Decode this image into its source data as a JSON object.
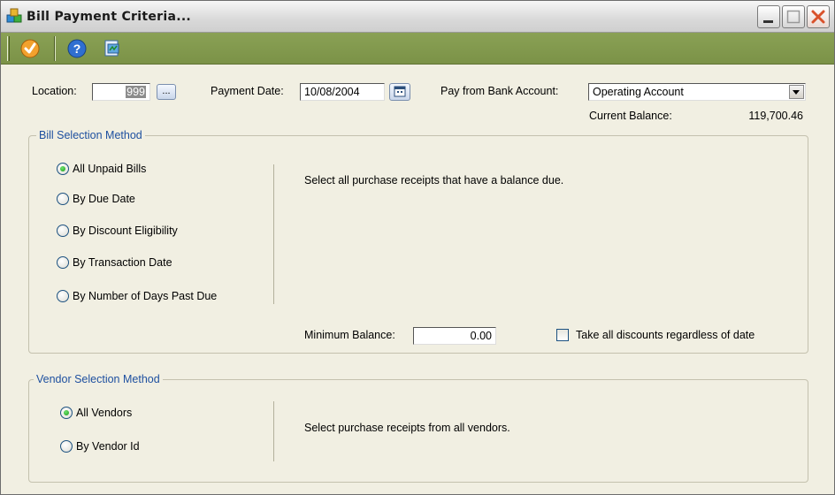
{
  "window": {
    "title": "Bill Payment Criteria..."
  },
  "toolbar": {
    "items": [
      {
        "name": "ok-checkmark-icon"
      },
      {
        "name": "help-icon"
      },
      {
        "name": "report-icon"
      }
    ]
  },
  "header": {
    "location_label": "Location:",
    "location_value": "999",
    "browse_label": "...",
    "payment_date_label": "Payment Date:",
    "payment_date_value": "10/08/2004",
    "bank_account_label": "Pay from Bank Account:",
    "bank_account_value": "Operating Account",
    "current_balance_label": "Current Balance:",
    "current_balance_value": "119,700.46"
  },
  "bill_selection": {
    "title": "Bill Selection Method",
    "options": [
      {
        "label": "All Unpaid Bills",
        "selected": true
      },
      {
        "label": "By Due Date",
        "selected": false
      },
      {
        "label": "By Discount Eligibility",
        "selected": false
      },
      {
        "label": "By Transaction Date",
        "selected": false
      },
      {
        "label": "By Number of Days Past Due",
        "selected": false
      }
    ],
    "description": "Select all purchase receipts that have a balance due.",
    "minimum_balance_label": "Minimum Balance:",
    "minimum_balance_value": "0.00",
    "take_discounts_label": "Take all discounts regardless of date",
    "take_discounts_checked": false
  },
  "vendor_selection": {
    "title": "Vendor Selection Method",
    "options": [
      {
        "label": "All Vendors",
        "selected": true
      },
      {
        "label": "By Vendor Id",
        "selected": false
      }
    ],
    "description": "Select purchase receipts from all vendors."
  },
  "colors": {
    "toolbar": "#7b9247",
    "group_title": "#1d4f9f",
    "close_button": "#d9512b"
  }
}
